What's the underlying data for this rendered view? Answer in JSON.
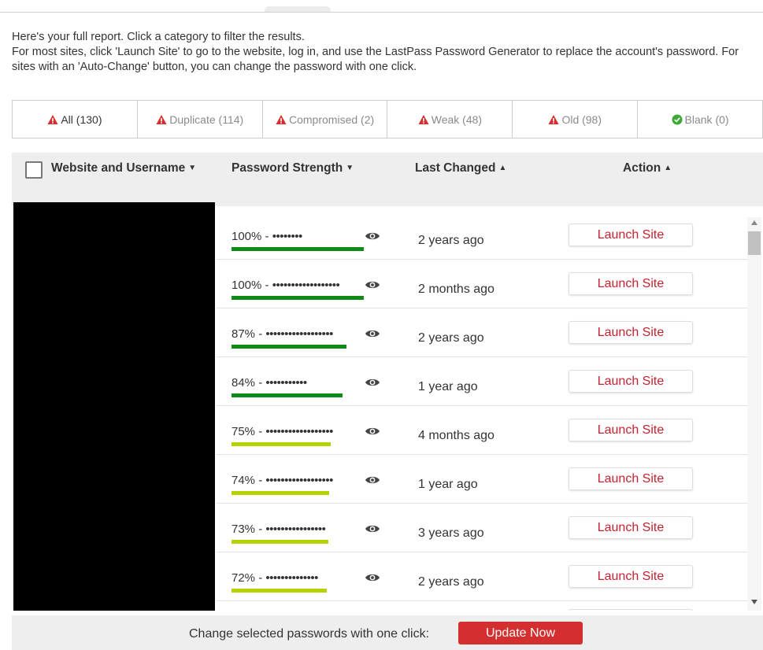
{
  "intro": {
    "line1": "Here's your full report. Click a category to filter the results.",
    "line2": "For most sites, click 'Launch Site' to go to the website, log in, and use the LastPass Password Generator to replace the account's password. For sites with an 'Auto-Change' button, you can change the password with one click."
  },
  "tabs": [
    {
      "label": "All (130)",
      "icon": "warning-icon"
    },
    {
      "label": "Duplicate (114)",
      "icon": "warning-icon"
    },
    {
      "label": "Compromised (2)",
      "icon": "warning-icon"
    },
    {
      "label": "Weak (48)",
      "icon": "warning-icon"
    },
    {
      "label": "Old (98)",
      "icon": "warning-icon"
    },
    {
      "label": "Blank (0)",
      "icon": "check-circle-icon"
    }
  ],
  "columns": {
    "website": "Website and Username",
    "strength": "Password Strength",
    "changed": "Last Changed",
    "action": "Action"
  },
  "rows": [
    {
      "strength": "100% - ",
      "dots": "••••••••",
      "changed": "2 years ago",
      "action": "Launch Site",
      "level": 100
    },
    {
      "strength": "100% - ",
      "dots": "••••••••••••••••••",
      "changed": "2 months ago",
      "action": "Launch Site",
      "level": 100
    },
    {
      "strength": "87% - ",
      "dots": "••••••••••••••••••",
      "changed": "2 years ago",
      "action": "Launch Site",
      "level": 87
    },
    {
      "strength": "84% - ",
      "dots": "•••••••••••",
      "changed": "1 year ago",
      "action": "Launch Site",
      "level": 84
    },
    {
      "strength": "75% - ",
      "dots": "••••••••••••••••••",
      "changed": "4 months ago",
      "action": "Launch Site",
      "level": 75
    },
    {
      "strength": "74% - ",
      "dots": "••••••••••••••••••",
      "changed": "1 year ago",
      "action": "Launch Site",
      "level": 74
    },
    {
      "strength": "73% - ",
      "dots": "••••••••••••••••",
      "changed": "3 years ago",
      "action": "Launch Site",
      "level": 73
    },
    {
      "strength": "72% - ",
      "dots": "••••••••••••••",
      "changed": "2 years ago",
      "action": "Launch Site",
      "level": 72
    }
  ],
  "colors": {
    "accent_red": "#d32f2f",
    "launch_text": "#c8202f",
    "strong_bar": "#0e8a16",
    "medium_bar": "#b5d300",
    "ok_icon": "#3aaa35"
  },
  "footer": {
    "text": "Change selected passwords with one click:",
    "button": "Update Now"
  }
}
